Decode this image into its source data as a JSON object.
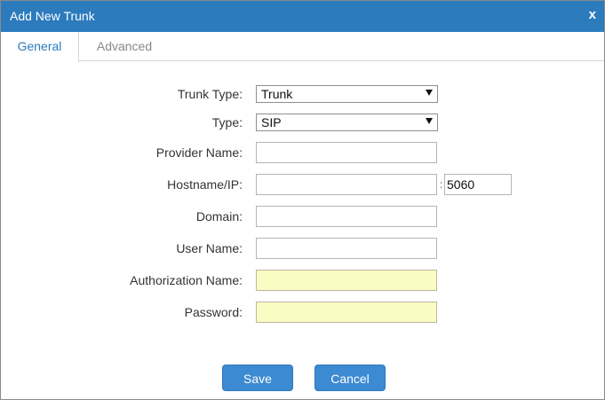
{
  "dialog": {
    "title": "Add New Trunk",
    "close_label": "x"
  },
  "tabs": [
    {
      "label": "General",
      "active": true
    },
    {
      "label": "Advanced",
      "active": false
    }
  ],
  "form": {
    "trunk_type": {
      "label": "Trunk Type:",
      "value": "Trunk"
    },
    "type": {
      "label": "Type:",
      "value": "SIP"
    },
    "provider_name": {
      "label": "Provider Name:",
      "value": ""
    },
    "hostname": {
      "label": "Hostname/IP:",
      "value": "",
      "port_separator": ":",
      "port": "5060"
    },
    "domain": {
      "label": "Domain:",
      "value": ""
    },
    "user_name": {
      "label": "User Name:",
      "value": ""
    },
    "authorization_name": {
      "label": "Authorization Name:",
      "value": ""
    },
    "password": {
      "label": "Password:",
      "value": ""
    }
  },
  "buttons": {
    "save": "Save",
    "cancel": "Cancel"
  },
  "colors": {
    "titlebar": "#2b7bbd",
    "button": "#3c8ad1",
    "autofill_field": "#fbfbc4"
  }
}
